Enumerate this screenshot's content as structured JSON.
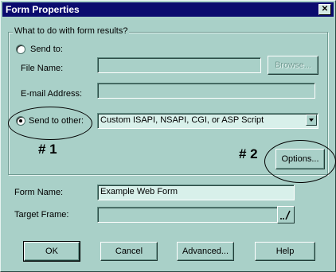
{
  "window": {
    "title": "Form Properties",
    "close_glyph": "✕"
  },
  "group": {
    "legend": "What to do with form results?"
  },
  "send_to": {
    "label": "Send to:",
    "selected": false
  },
  "file_name": {
    "label": "File Name:",
    "value": ""
  },
  "browse_button": {
    "label": "Browse...",
    "enabled": false
  },
  "email": {
    "label": "E-mail Address:",
    "value": ""
  },
  "send_to_other": {
    "label": "Send to other:",
    "selected": true,
    "select_value": "Custom ISAPI, NSAPI, CGI, or ASP Script"
  },
  "annotations": {
    "one": "# 1",
    "two": "# 2"
  },
  "options_button": {
    "label": "Options..."
  },
  "form_name": {
    "label": "Form Name:",
    "value": "Example Web Form"
  },
  "target_frame": {
    "label": "Target Frame:",
    "value": ""
  },
  "pencil_icon": "pencil-icon",
  "buttons": {
    "ok": "OK",
    "cancel": "Cancel",
    "advanced": "Advanced...",
    "help": "Help"
  }
}
